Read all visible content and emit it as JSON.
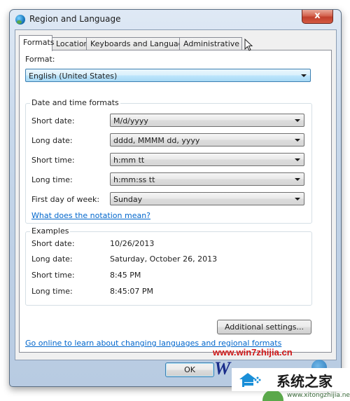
{
  "window": {
    "title": "Region and Language",
    "close_label": "x"
  },
  "tabs": [
    {
      "label": "Formats",
      "active": true
    },
    {
      "label": "Location",
      "active": false
    },
    {
      "label": "Keyboards and Languages",
      "active": false
    },
    {
      "label": "Administrative",
      "active": false
    }
  ],
  "format": {
    "label": "Format:",
    "value": "English (United States)"
  },
  "date_time_formats": {
    "title": "Date and time formats",
    "rows": [
      {
        "label": "Short date:",
        "value": "M/d/yyyy"
      },
      {
        "label": "Long date:",
        "value": "dddd, MMMM dd, yyyy"
      },
      {
        "label": "Short time:",
        "value": "h:mm tt"
      },
      {
        "label": "Long time:",
        "value": "h:mm:ss tt"
      },
      {
        "label": "First day of week:",
        "value": "Sunday"
      }
    ],
    "notation_link": "What does the notation mean?"
  },
  "examples": {
    "title": "Examples",
    "rows": [
      {
        "label": "Short date:",
        "value": "10/26/2013"
      },
      {
        "label": "Long date:",
        "value": "Saturday, October 26, 2013"
      },
      {
        "label": "Short time:",
        "value": "8:45 PM"
      },
      {
        "label": "Long time:",
        "value": "8:45:07 PM"
      }
    ]
  },
  "additional_settings_label": "Additional settings...",
  "online_link": "Go online to learn about changing languages and regional formats",
  "buttons": {
    "ok": "OK"
  },
  "watermark": {
    "url": "www.win7zhijia.cn",
    "logo_letter": "W",
    "chinese_text": "系统之家",
    "sub_text": "www.xitongzhijia.net"
  },
  "colors": {
    "link": "#0066cc",
    "watermark_red": "#d01818",
    "close_red": "#c1402c"
  }
}
